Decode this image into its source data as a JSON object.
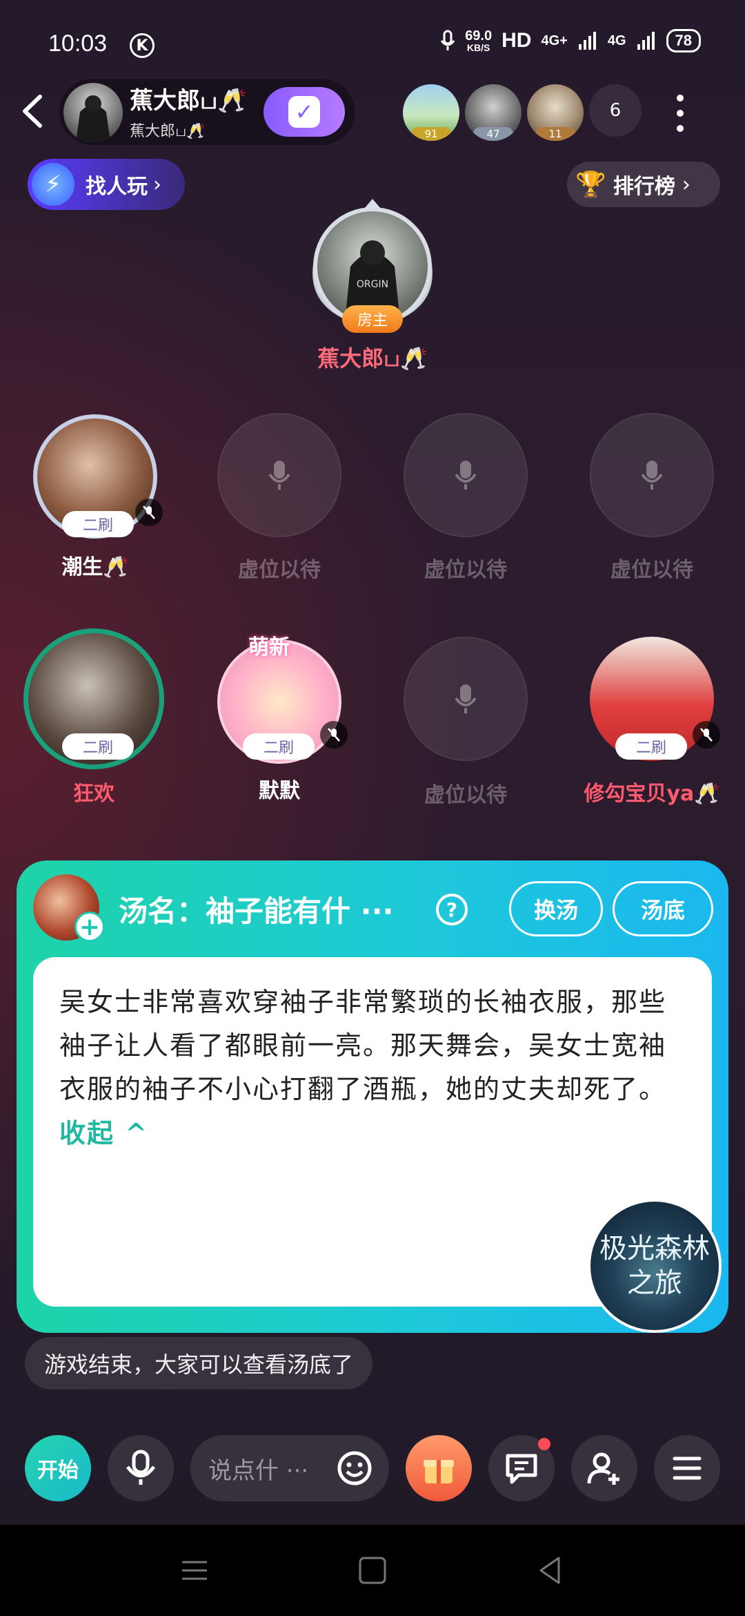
{
  "status_bar": {
    "time": "10:03",
    "k_icon": "K",
    "speed_value": "69.0",
    "speed_unit": "KB/S",
    "hd": "HD",
    "signal1": "4G+",
    "signal2": "4G",
    "battery": "78"
  },
  "room": {
    "name": "蕉大郎ப🥂",
    "sub": "蕉大郎ப🥂",
    "follow_icon": "check-icon"
  },
  "audience": {
    "badges": [
      "91",
      "47",
      "11"
    ],
    "count": "6"
  },
  "find_player": {
    "label": "找人玩"
  },
  "leaderboard": {
    "label": "排行榜"
  },
  "host": {
    "tag": "房主",
    "name": "蕉大郎ப🥂"
  },
  "seats": [
    {
      "name": "潮生🥂",
      "tag": "二刷",
      "occupied": true
    },
    {
      "name": "虚位以待",
      "occupied": false
    },
    {
      "name": "虚位以待",
      "occupied": false
    },
    {
      "name": "虚位以待",
      "occupied": false
    },
    {
      "name": "狂欢",
      "tag": "二刷",
      "occupied": true
    },
    {
      "name": "默默",
      "tag": "二刷",
      "occupied": true,
      "badge": "萌新"
    },
    {
      "name": "虚位以待",
      "occupied": false
    },
    {
      "name": "修勾宝贝ya🥂",
      "tag": "二刷",
      "occupied": true
    }
  ],
  "puzzle": {
    "title": "汤名：袖子能有什 ···",
    "help": "?",
    "change_button": "换汤",
    "answer_button": "汤底",
    "text": "吴女士非常喜欢穿袖子非常繁琐的长袖衣服，那些袖子让人看了都眼前一亮。那天舞会，吴女士宽袖衣服的袖子不小心打翻了酒瓶，她的丈夫却死了。",
    "collapse": "收起 ^",
    "badge_line1": "极光森林",
    "badge_line2": "之旅"
  },
  "system_message": "游戏结束，大家可以查看汤底了",
  "toolbar": {
    "start": "开始",
    "input_placeholder": "说点什 ···"
  },
  "colors": {
    "accent_teal": "#1ed3a8",
    "accent_blue": "#1ab8ef",
    "name_red": "#ff5a6e",
    "follow_purple": "#8a5cff"
  }
}
